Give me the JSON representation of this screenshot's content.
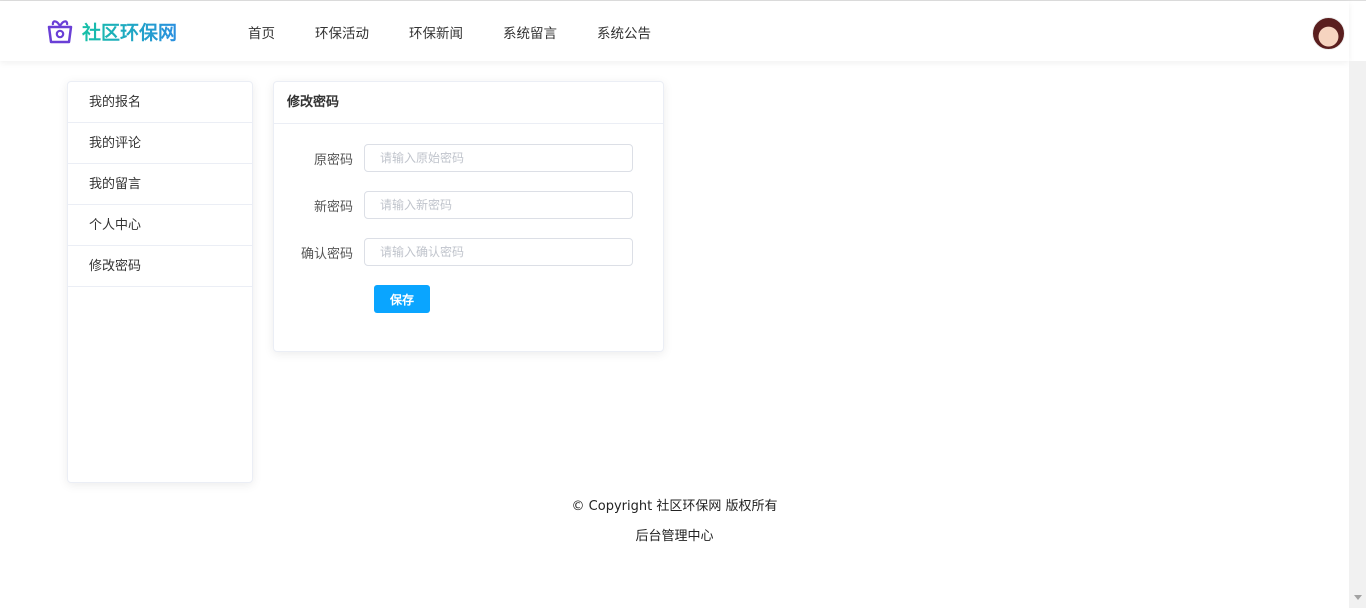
{
  "header": {
    "logo_text": "社区环保网",
    "nav": [
      "首页",
      "环保活动",
      "环保新闻",
      "系统留言",
      "系统公告"
    ]
  },
  "sidebar": {
    "items": [
      "我的报名",
      "我的评论",
      "我的留言",
      "个人中心",
      "修改密码"
    ]
  },
  "form": {
    "title": "修改密码",
    "fields": [
      {
        "label": "原密码",
        "placeholder": "请输入原始密码"
      },
      {
        "label": "新密码",
        "placeholder": "请输入新密码"
      },
      {
        "label": "确认密码",
        "placeholder": "请输入确认密码"
      }
    ],
    "save_label": "保存"
  },
  "footer": {
    "copyright": "© Copyright 社区环保网 版权所有",
    "admin_link": "后台管理中心"
  }
}
